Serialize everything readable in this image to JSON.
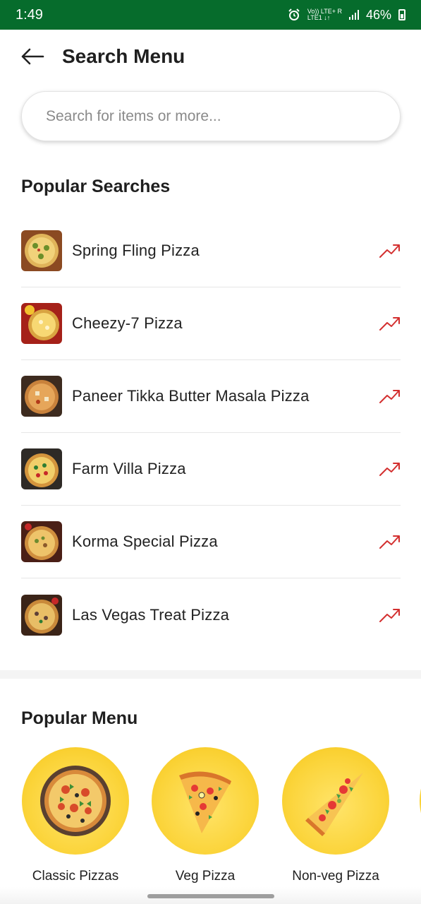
{
  "status_bar": {
    "time": "1:49",
    "network_top": "Vo)) LTE+ R",
    "network_bottom": "LTE1 ↓↑",
    "battery": "46%"
  },
  "header": {
    "title": "Search Menu",
    "back_icon": "arrow-left-icon"
  },
  "search": {
    "placeholder": "Search for items or more..."
  },
  "popular_searches": {
    "title": "Popular Searches",
    "trend_color": "#d32f2f",
    "items": [
      {
        "label": "Spring Fling Pizza"
      },
      {
        "label": "Cheezy-7 Pizza"
      },
      {
        "label": "Paneer Tikka Butter Masala Pizza"
      },
      {
        "label": "Farm Villa Pizza"
      },
      {
        "label": "Korma Special Pizza"
      },
      {
        "label": "Las Vegas Treat Pizza"
      }
    ]
  },
  "popular_menu": {
    "title": "Popular Menu",
    "items": [
      {
        "label": "Classic Pizzas"
      },
      {
        "label": "Veg Pizza"
      },
      {
        "label": "Non-veg Pizza"
      },
      {
        "label": ""
      }
    ]
  },
  "colors": {
    "status_bar": "#066c2c",
    "menu_circle": "#fbd43a"
  }
}
